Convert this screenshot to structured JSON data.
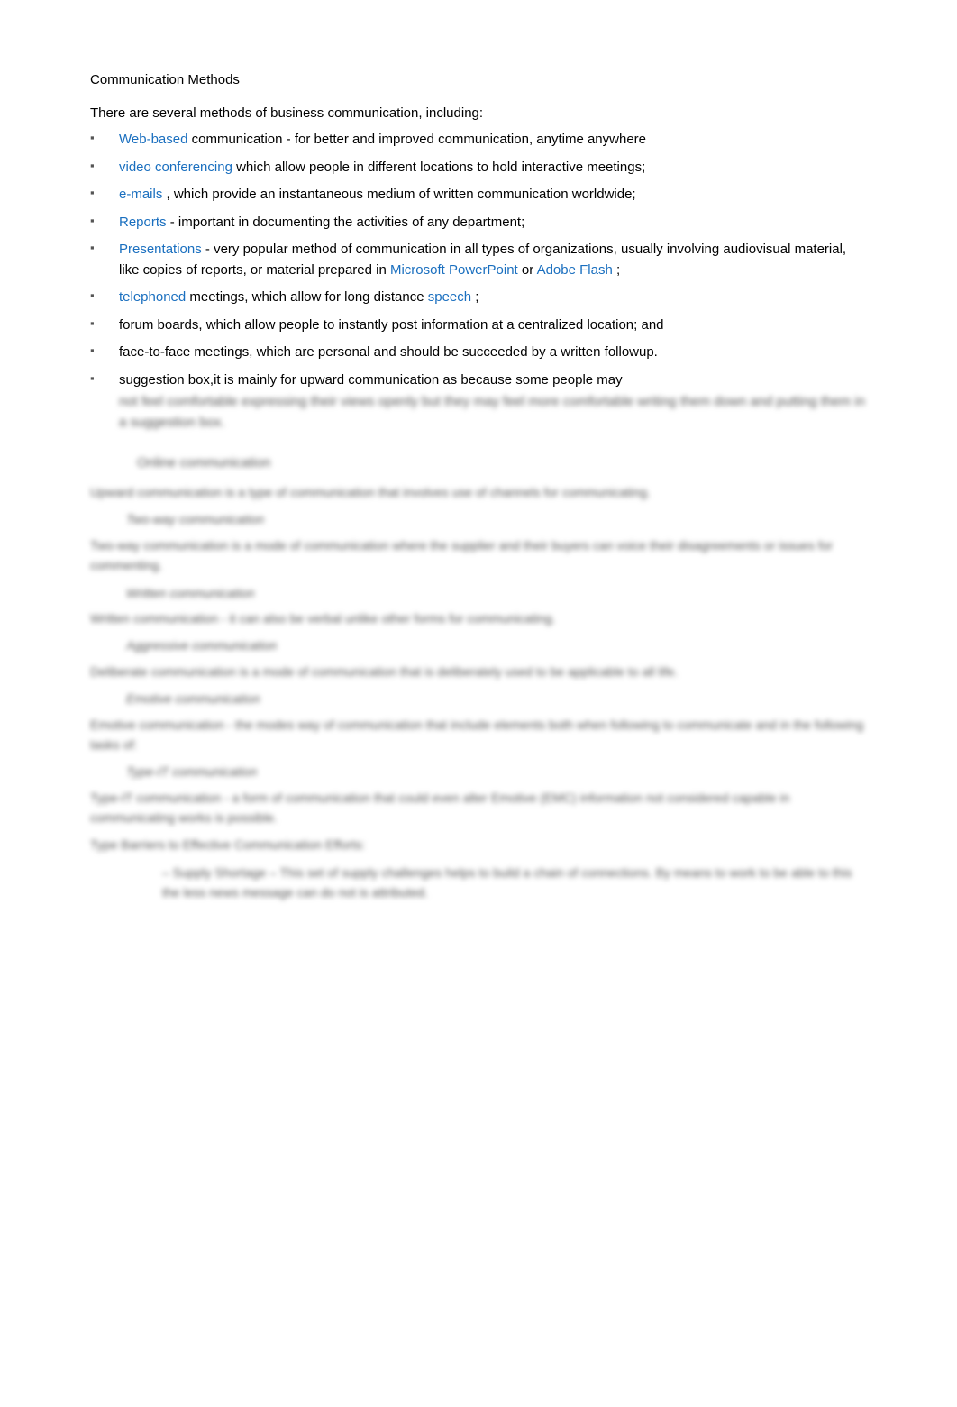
{
  "page": {
    "title": "Communication Methods",
    "intro": "There are several methods of business communication, including:",
    "bullet_icon": "▪",
    "items": [
      {
        "link_text": "Web-based",
        "rest_text": " communication - for better and improved communication, anytime anywhere"
      },
      {
        "link_text": "video conferencing",
        "rest_text": " which allow people in different locations to hold interactive meetings;"
      },
      {
        "link_text": "e-mails",
        "rest_text": ", which provide an instantaneous medium of written communication worldwide;"
      },
      {
        "link_text": "Reports",
        "rest_text": " - important in documenting the activities of any department;"
      },
      {
        "link_text": "Presentations",
        "rest_text": " - very popular method of communication in all types of organizations, usually involving audiovisual material, like copies of reports, or material prepared in ",
        "link2_text": "Microsoft PowerPoint",
        "link2_sep": " or ",
        "link3_text": "Adobe Flash",
        "end_text": ";"
      },
      {
        "link_text": "telephoned",
        "rest_text": " meetings, which allow for long distance ",
        "link2_text": "speech",
        "end_text": ";"
      },
      {
        "link_text": null,
        "plain_text": "forum boards, which allow people to instantly post information at a centralized location; and"
      },
      {
        "link_text": null,
        "plain_text": "face-to-face meetings, which are personal and should be succeeded by a written followup."
      },
      {
        "link_text": null,
        "plain_text": "suggestion box,it is mainly for upward communication as because some people may",
        "blurred_sub": "not feel comfortable expressing their views openly but they may feel more comfortable writing them down and putting them in a suggestion box."
      }
    ],
    "blurred_sections": [
      {
        "main_text": "Upward communication is a type of communication that involves use of channels for communicating.",
        "sub_label": "Two-way communication"
      },
      {
        "main_text": "Two-way communication is a mode of communication where the supplier and their buyers can voice their disagreements or issues for commenting.",
        "sub_label": "Written communication"
      },
      {
        "main_text": "Written communication - it can also be verbal unlike other forms for communicating.",
        "sub_label": "Aggressive communication"
      },
      {
        "main_text": "Deliberate communication is a mode of communication that is deliberately used to be applicable to all life.",
        "sub_label": "Emotive communication"
      },
      {
        "main_text": "Emotive communication - the modes way of communication that include elements both when following to communicate and in the following tasks of:",
        "sub_label": "Type-IT communication"
      },
      {
        "main_text": "Type-IT communication - a form of communication that could even alter Emotive (EMC) information not considered capable in communicating works is possible.",
        "sub_label": null
      },
      {
        "main_text": "Type Barriers to Effective Communication Efforts:",
        "sub_label": null,
        "sub2_text": "– Supply Shortage – This set of supply challenges helps to build a chain of connections. By means to work to be able to this the less news message can do not is attributed."
      }
    ]
  }
}
